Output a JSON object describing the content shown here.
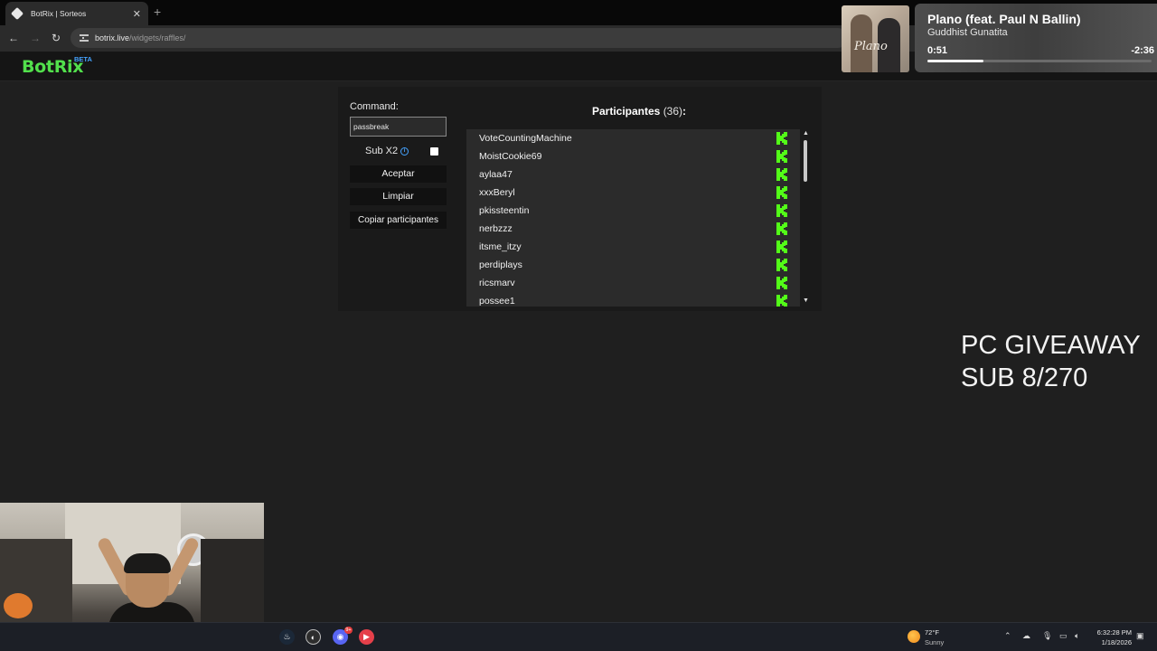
{
  "browser": {
    "tab_title": "BotRix | Sorteos",
    "tab_close": "✕",
    "new_tab": "+",
    "url_host": "botrix.live",
    "url_path": "/widgets/raffles/"
  },
  "site": {
    "logo": "BotRix",
    "logo_badge": "BETA"
  },
  "raffle": {
    "command_label": "Command:",
    "command_value": "passbreak",
    "sub_label": "Sub X2",
    "sub_checked": false,
    "accept_label": "Aceptar",
    "clear_label": "Limpiar",
    "copy_label": "Copiar participantes",
    "participants_title": "Participantes",
    "participants_count": "(36)",
    "participants_suffix": ":",
    "participants": [
      "VoteCountingMachine",
      "MoistCookie69",
      "aylaa47",
      "xxxBeryl",
      "pkissteentin",
      "nerbzzz",
      "itsme_itzy",
      "perdiplays",
      "ricsmarv",
      "possee1"
    ],
    "platform_icon": "kick-icon",
    "platform_color": "#53fc18"
  },
  "now_playing": {
    "title": "Plano (feat. Paul N Ballin)",
    "artist": "Guddhist Gunatita",
    "elapsed": "0:51",
    "remaining": "-2:36",
    "progress": 0.25,
    "art_text": "Plano"
  },
  "overlay": {
    "giveaway_line1": "PC GIVEAWAY",
    "giveaway_line2": "SUB 8/270"
  },
  "taskbar": {
    "weather_temp": "72°F",
    "weather_desc": "Sunny",
    "time": "6:32:28 PM",
    "date": "1/18/2026",
    "discord_badge": "9+"
  }
}
